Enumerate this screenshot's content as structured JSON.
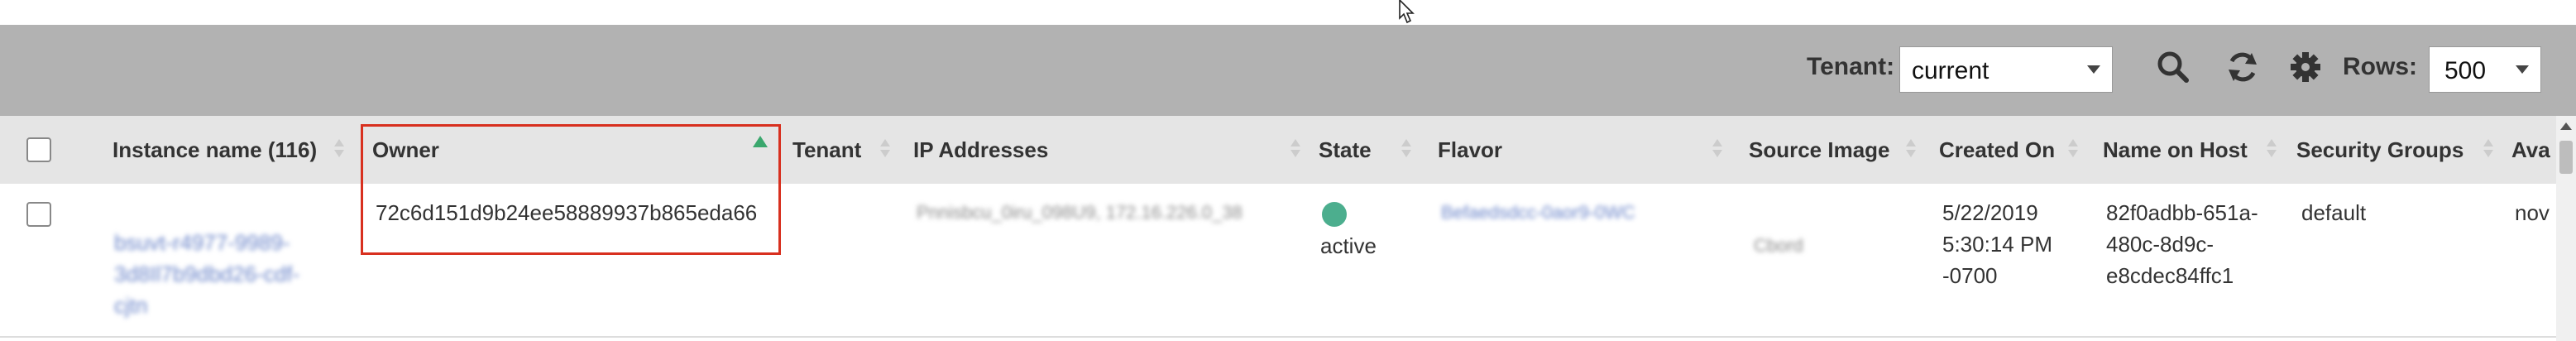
{
  "toolbar": {
    "tenant_label": "Tenant:",
    "tenant_value": "current",
    "rows_label": "Rows:",
    "rows_value": "500"
  },
  "table": {
    "columns": [
      {
        "key": "instance_name",
        "label": "Instance name (116)"
      },
      {
        "key": "owner",
        "label": "Owner",
        "sort": "ascending"
      },
      {
        "key": "tenant",
        "label": "Tenant"
      },
      {
        "key": "ip_addresses",
        "label": "IP Addresses"
      },
      {
        "key": "state",
        "label": "State"
      },
      {
        "key": "flavor",
        "label": "Flavor"
      },
      {
        "key": "source_image",
        "label": "Source Image"
      },
      {
        "key": "created_on",
        "label": "Created On"
      },
      {
        "key": "name_on_host",
        "label": "Name on Host"
      },
      {
        "key": "security_groups",
        "label": "Security Groups"
      },
      {
        "key": "availability",
        "label": "Ava"
      }
    ],
    "rows": [
      {
        "instance_name_lines": [
          "bsuvt-r4977-9989-",
          "3d8Il7b9dbd26-cdf-",
          "cjtn"
        ],
        "owner": "72c6d151d9b24ee58889937b865eda66",
        "tenant": "",
        "ip_addresses": "Pnnisbcu_0iru_098U9, 172.16.226.0_38",
        "state": "active",
        "state_color": "#4cae8e",
        "flavor": "Befaedsdcc-0aor9-0WC",
        "source_image": "Cbord",
        "created_on_lines": [
          "5/22/2019",
          "5:30:14 PM",
          "-0700"
        ],
        "name_on_host_lines": [
          "82f0adbb-651a-",
          "480c-8d9c-",
          "e8cdec84ffc1"
        ],
        "security_groups": "default",
        "availability": "nov"
      }
    ]
  },
  "colors": {
    "toolbar_bg": "#b2b2b2",
    "header_bg": "#e5e5e5",
    "highlight_border": "#d8301f",
    "sort_indicator": "#3aa76d"
  }
}
